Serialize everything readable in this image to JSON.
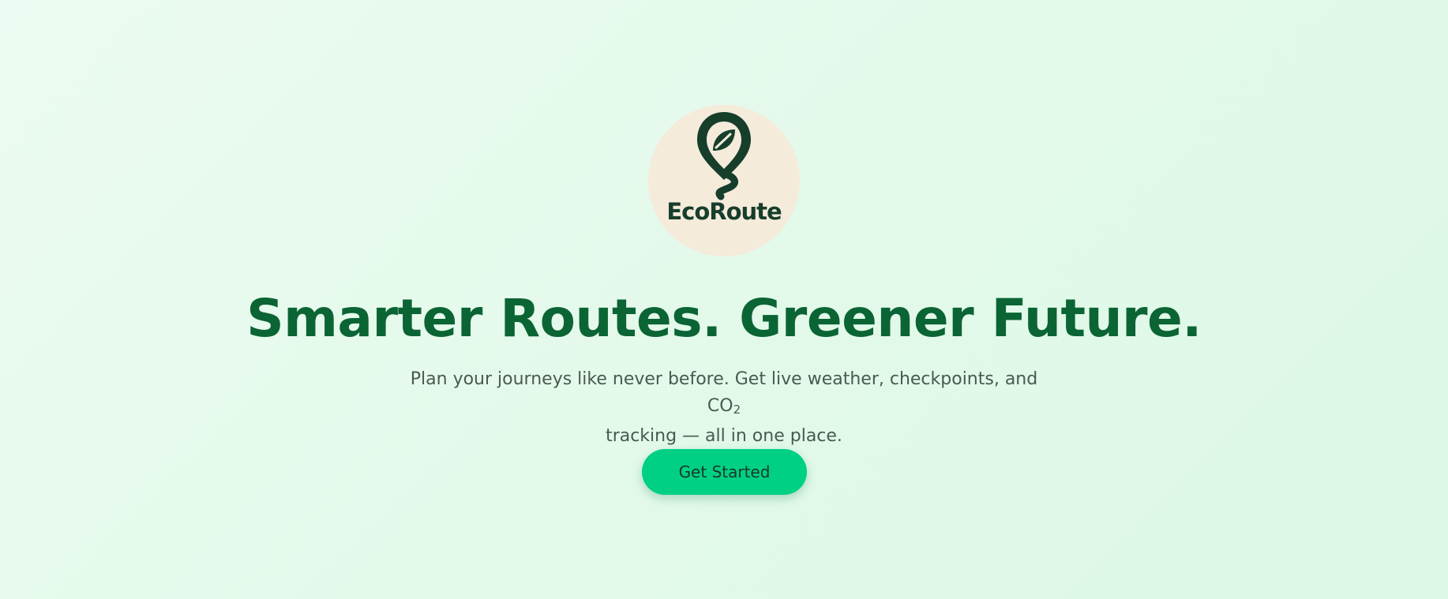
{
  "brand": {
    "name": "EcoRoute",
    "logo_icon": "map-pin-leaf-icon",
    "colors": {
      "primary_green": "#0b6434",
      "logo_dark": "#173d2b",
      "logo_bg": "#f4ebdb",
      "cta": "#00d084"
    }
  },
  "hero": {
    "headline": "Smarter Routes. Greener Future.",
    "subtitle_line1": "Plan your journeys like never before. Get live weather, checkpoints, and CO",
    "subtitle_subscript": "2",
    "subtitle_line2": "tracking — all in one place.",
    "cta_label": "Get Started"
  }
}
